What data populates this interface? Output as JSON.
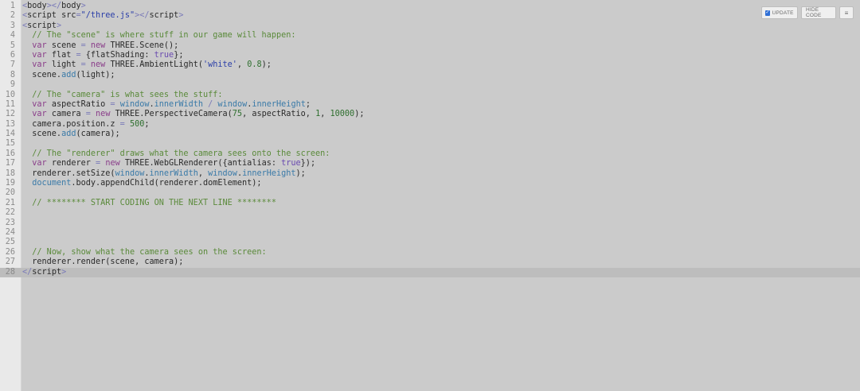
{
  "toolbar": {
    "update_label": "UPDATE",
    "update_checked": true,
    "hide_code_label": "HIDE CODE",
    "menu_glyph": "≡",
    "checkbox_icon": "checkbox-checked-icon",
    "menu_icon": "hamburger-menu-icon"
  },
  "editor": {
    "active_line": 28,
    "lines": [
      {
        "n": "1",
        "t": [
          [
            "tag",
            "<"
          ],
          [
            "",
            "body"
          ],
          [
            "tag",
            "></"
          ],
          [
            "",
            "body"
          ],
          [
            "tag",
            ">"
          ]
        ]
      },
      {
        "n": "2",
        "t": [
          [
            "tag",
            "<"
          ],
          [
            "",
            "script "
          ],
          [
            "",
            "src"
          ],
          [
            "op",
            "="
          ],
          [
            "string",
            "\"/three.js\""
          ],
          [
            "tag",
            "></"
          ],
          [
            "",
            "script"
          ],
          [
            "tag",
            ">"
          ]
        ]
      },
      {
        "n": "3",
        "t": [
          [
            "tag",
            "<"
          ],
          [
            "",
            "script"
          ],
          [
            "tag",
            ">"
          ]
        ]
      },
      {
        "n": "4",
        "t": [
          [
            "",
            "  "
          ],
          [
            "comment",
            "// The \"scene\" is where stuff in our game will happen:"
          ]
        ]
      },
      {
        "n": "5",
        "t": [
          [
            "",
            "  "
          ],
          [
            "keyword",
            "var"
          ],
          [
            "",
            " scene "
          ],
          [
            "op",
            "="
          ],
          [
            "",
            " "
          ],
          [
            "keyword",
            "new"
          ],
          [
            "",
            " THREE.Scene();"
          ]
        ]
      },
      {
        "n": "6",
        "t": [
          [
            "",
            "  "
          ],
          [
            "keyword",
            "var"
          ],
          [
            "",
            " flat "
          ],
          [
            "op",
            "="
          ],
          [
            "",
            " {flatShading: "
          ],
          [
            "atom",
            "true"
          ],
          [
            "",
            "};"
          ]
        ]
      },
      {
        "n": "7",
        "t": [
          [
            "",
            "  "
          ],
          [
            "keyword",
            "var"
          ],
          [
            "",
            " light "
          ],
          [
            "op",
            "="
          ],
          [
            "",
            " "
          ],
          [
            "keyword",
            "new"
          ],
          [
            "",
            " THREE.AmbientLight("
          ],
          [
            "string",
            "'white'"
          ],
          [
            "",
            ", "
          ],
          [
            "number",
            "0.8"
          ],
          [
            "",
            ");"
          ]
        ]
      },
      {
        "n": "8",
        "t": [
          [
            "",
            "  scene."
          ],
          [
            "builtin",
            "add"
          ],
          [
            "",
            "(light);"
          ]
        ]
      },
      {
        "n": "9",
        "t": []
      },
      {
        "n": "10",
        "t": [
          [
            "",
            "  "
          ],
          [
            "comment",
            "// The \"camera\" is what sees the stuff:"
          ]
        ]
      },
      {
        "n": "11",
        "t": [
          [
            "",
            "  "
          ],
          [
            "keyword",
            "var"
          ],
          [
            "",
            " aspectRatio "
          ],
          [
            "op",
            "="
          ],
          [
            "",
            " "
          ],
          [
            "builtin",
            "window"
          ],
          [
            "",
            "."
          ],
          [
            "builtin",
            "innerWidth"
          ],
          [
            "",
            " "
          ],
          [
            "op",
            "/"
          ],
          [
            "",
            " "
          ],
          [
            "builtin",
            "window"
          ],
          [
            "",
            "."
          ],
          [
            "builtin",
            "innerHeight"
          ],
          [
            "",
            ";"
          ]
        ]
      },
      {
        "n": "12",
        "t": [
          [
            "",
            "  "
          ],
          [
            "keyword",
            "var"
          ],
          [
            "",
            " camera "
          ],
          [
            "op",
            "="
          ],
          [
            "",
            " "
          ],
          [
            "keyword",
            "new"
          ],
          [
            "",
            " THREE.PerspectiveCamera("
          ],
          [
            "number",
            "75"
          ],
          [
            "",
            ", aspectRatio, "
          ],
          [
            "number",
            "1"
          ],
          [
            "",
            ", "
          ],
          [
            "number",
            "10000"
          ],
          [
            "",
            ");"
          ]
        ]
      },
      {
        "n": "13",
        "t": [
          [
            "",
            "  camera.position.z "
          ],
          [
            "op",
            "="
          ],
          [
            "",
            " "
          ],
          [
            "number",
            "500"
          ],
          [
            "",
            ";"
          ]
        ]
      },
      {
        "n": "14",
        "t": [
          [
            "",
            "  scene."
          ],
          [
            "builtin",
            "add"
          ],
          [
            "",
            "(camera);"
          ]
        ]
      },
      {
        "n": "15",
        "t": []
      },
      {
        "n": "16",
        "t": [
          [
            "",
            "  "
          ],
          [
            "comment",
            "// The \"renderer\" draws what the camera sees onto the screen:"
          ]
        ]
      },
      {
        "n": "17",
        "t": [
          [
            "",
            "  "
          ],
          [
            "keyword",
            "var"
          ],
          [
            "",
            " renderer "
          ],
          [
            "op",
            "="
          ],
          [
            "",
            " "
          ],
          [
            "keyword",
            "new"
          ],
          [
            "",
            " THREE.WebGLRenderer({antialias: "
          ],
          [
            "atom",
            "true"
          ],
          [
            "",
            "});"
          ]
        ]
      },
      {
        "n": "18",
        "t": [
          [
            "",
            "  renderer.setSize("
          ],
          [
            "builtin",
            "window"
          ],
          [
            "",
            "."
          ],
          [
            "builtin",
            "innerWidth"
          ],
          [
            "",
            ", "
          ],
          [
            "builtin",
            "window"
          ],
          [
            "",
            "."
          ],
          [
            "builtin",
            "innerHeight"
          ],
          [
            "",
            ");"
          ]
        ]
      },
      {
        "n": "19",
        "t": [
          [
            "",
            "  "
          ],
          [
            "builtin",
            "document"
          ],
          [
            "",
            ".body.appendChild(renderer.domElement);"
          ]
        ]
      },
      {
        "n": "20",
        "t": []
      },
      {
        "n": "21",
        "t": [
          [
            "",
            "  "
          ],
          [
            "comment",
            "// ******** START CODING ON THE NEXT LINE ********"
          ]
        ]
      },
      {
        "n": "22",
        "t": []
      },
      {
        "n": "23",
        "t": []
      },
      {
        "n": "24",
        "t": []
      },
      {
        "n": "25",
        "t": []
      },
      {
        "n": "26",
        "t": [
          [
            "",
            "  "
          ],
          [
            "comment",
            "// Now, show what the camera sees on the screen:"
          ]
        ]
      },
      {
        "n": "27",
        "t": [
          [
            "",
            "  renderer.render(scene, camera);"
          ]
        ]
      },
      {
        "n": "28",
        "t": [
          [
            "tag",
            "</"
          ],
          [
            "",
            "script"
          ],
          [
            "tag",
            ">"
          ]
        ]
      }
    ]
  }
}
